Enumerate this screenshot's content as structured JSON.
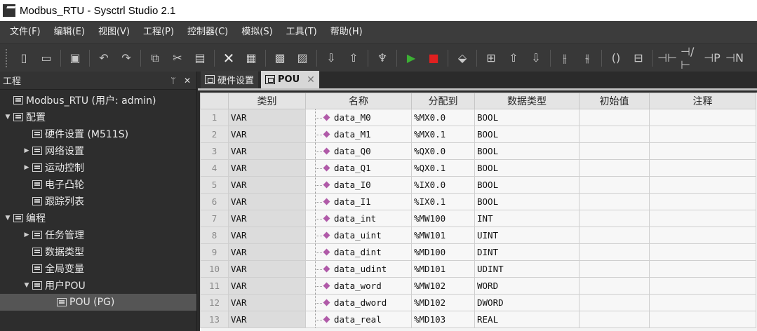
{
  "window": {
    "title": "Modbus_RTU - Sysctrl Studio 2.1"
  },
  "menu": [
    "文件(F)",
    "编辑(E)",
    "视图(V)",
    "工程(P)",
    "控制器(C)",
    "模拟(S)",
    "工具(T)",
    "帮助(H)"
  ],
  "toolbar": {
    "icons": [
      "new-file-icon",
      "open-folder-icon",
      "save-icon",
      "undo-icon",
      "redo-icon",
      "copy-icon",
      "cut-icon",
      "paste-icon",
      "delete-icon",
      "compile-icon",
      "build-icon",
      "clean-icon",
      "download-icon",
      "upload-icon",
      "monitor-icon",
      "run-icon",
      "stop-icon",
      "diagnostic-icon",
      "insert-row-icon",
      "move-up-icon",
      "move-down-icon",
      "contact-nc-icon",
      "contact-no-icon",
      "coil-icon",
      "function-block-icon",
      "contact-icon",
      "negated-contact-icon",
      "rising-edge-icon",
      "falling-edge-icon"
    ]
  },
  "left_panel": {
    "title": "工程",
    "pin_glyph": "ᛘ",
    "close_glyph": "✕",
    "tree": [
      {
        "label": "Modbus_RTU (用户: admin)",
        "level": 0,
        "expand": ""
      },
      {
        "label": "配置",
        "level": 0,
        "expand": "▼"
      },
      {
        "label": "硬件设置 (M511S)",
        "level": 1,
        "expand": ""
      },
      {
        "label": "网络设置",
        "level": 1,
        "expand": "▶"
      },
      {
        "label": "运动控制",
        "level": 1,
        "expand": "▶"
      },
      {
        "label": "电子凸轮",
        "level": 1,
        "expand": ""
      },
      {
        "label": "跟踪列表",
        "level": 1,
        "expand": ""
      },
      {
        "label": "编程",
        "level": 0,
        "expand": "▼"
      },
      {
        "label": "任务管理",
        "level": 1,
        "expand": "▶"
      },
      {
        "label": "数据类型",
        "level": 1,
        "expand": ""
      },
      {
        "label": "全局变量",
        "level": 1,
        "expand": ""
      },
      {
        "label": "用户POU",
        "level": 1,
        "expand": "▼"
      },
      {
        "label": "POU (PG)",
        "level": 2,
        "expand": "",
        "selected": true
      }
    ]
  },
  "tabs": [
    {
      "label": "硬件设置",
      "active": false
    },
    {
      "label": "POU",
      "active": true,
      "close": "✕"
    }
  ],
  "table": {
    "columns": [
      "",
      "类别",
      "名称",
      "分配到",
      "数据类型",
      "初始值",
      "注释"
    ],
    "rows": [
      {
        "num": "1",
        "category": "VAR",
        "name": "data_M0",
        "address": "%MX0.0",
        "type": "BOOL",
        "init": "",
        "comment": ""
      },
      {
        "num": "2",
        "category": "VAR",
        "name": "data_M1",
        "address": "%MX0.1",
        "type": "BOOL",
        "init": "",
        "comment": ""
      },
      {
        "num": "3",
        "category": "VAR",
        "name": "data_Q0",
        "address": "%QX0.0",
        "type": "BOOL",
        "init": "",
        "comment": ""
      },
      {
        "num": "4",
        "category": "VAR",
        "name": "data_Q1",
        "address": "%QX0.1",
        "type": "BOOL",
        "init": "",
        "comment": ""
      },
      {
        "num": "5",
        "category": "VAR",
        "name": "data_I0",
        "address": "%IX0.0",
        "type": "BOOL",
        "init": "",
        "comment": ""
      },
      {
        "num": "6",
        "category": "VAR",
        "name": "data_I1",
        "address": "%IX0.1",
        "type": "BOOL",
        "init": "",
        "comment": ""
      },
      {
        "num": "7",
        "category": "VAR",
        "name": "data_int",
        "address": "%MW100",
        "type": "INT",
        "init": "",
        "comment": ""
      },
      {
        "num": "8",
        "category": "VAR",
        "name": "data_uint",
        "address": "%MW101",
        "type": "UINT",
        "init": "",
        "comment": ""
      },
      {
        "num": "9",
        "category": "VAR",
        "name": "data_dint",
        "address": "%MD100",
        "type": "DINT",
        "init": "",
        "comment": ""
      },
      {
        "num": "10",
        "category": "VAR",
        "name": "data_udint",
        "address": "%MD101",
        "type": "UDINT",
        "init": "",
        "comment": ""
      },
      {
        "num": "11",
        "category": "VAR",
        "name": "data_word",
        "address": "%MW102",
        "type": "WORD",
        "init": "",
        "comment": ""
      },
      {
        "num": "12",
        "category": "VAR",
        "name": "data_dword",
        "address": "%MD102",
        "type": "DWORD",
        "init": "",
        "comment": ""
      },
      {
        "num": "13",
        "category": "VAR",
        "name": "data_real",
        "address": "%MD103",
        "type": "REAL",
        "init": "",
        "comment": ""
      }
    ]
  },
  "colors": {
    "accent_var_icon": "#b05aa8",
    "run_green": "#3cb034",
    "stop_red": "#e02020"
  }
}
